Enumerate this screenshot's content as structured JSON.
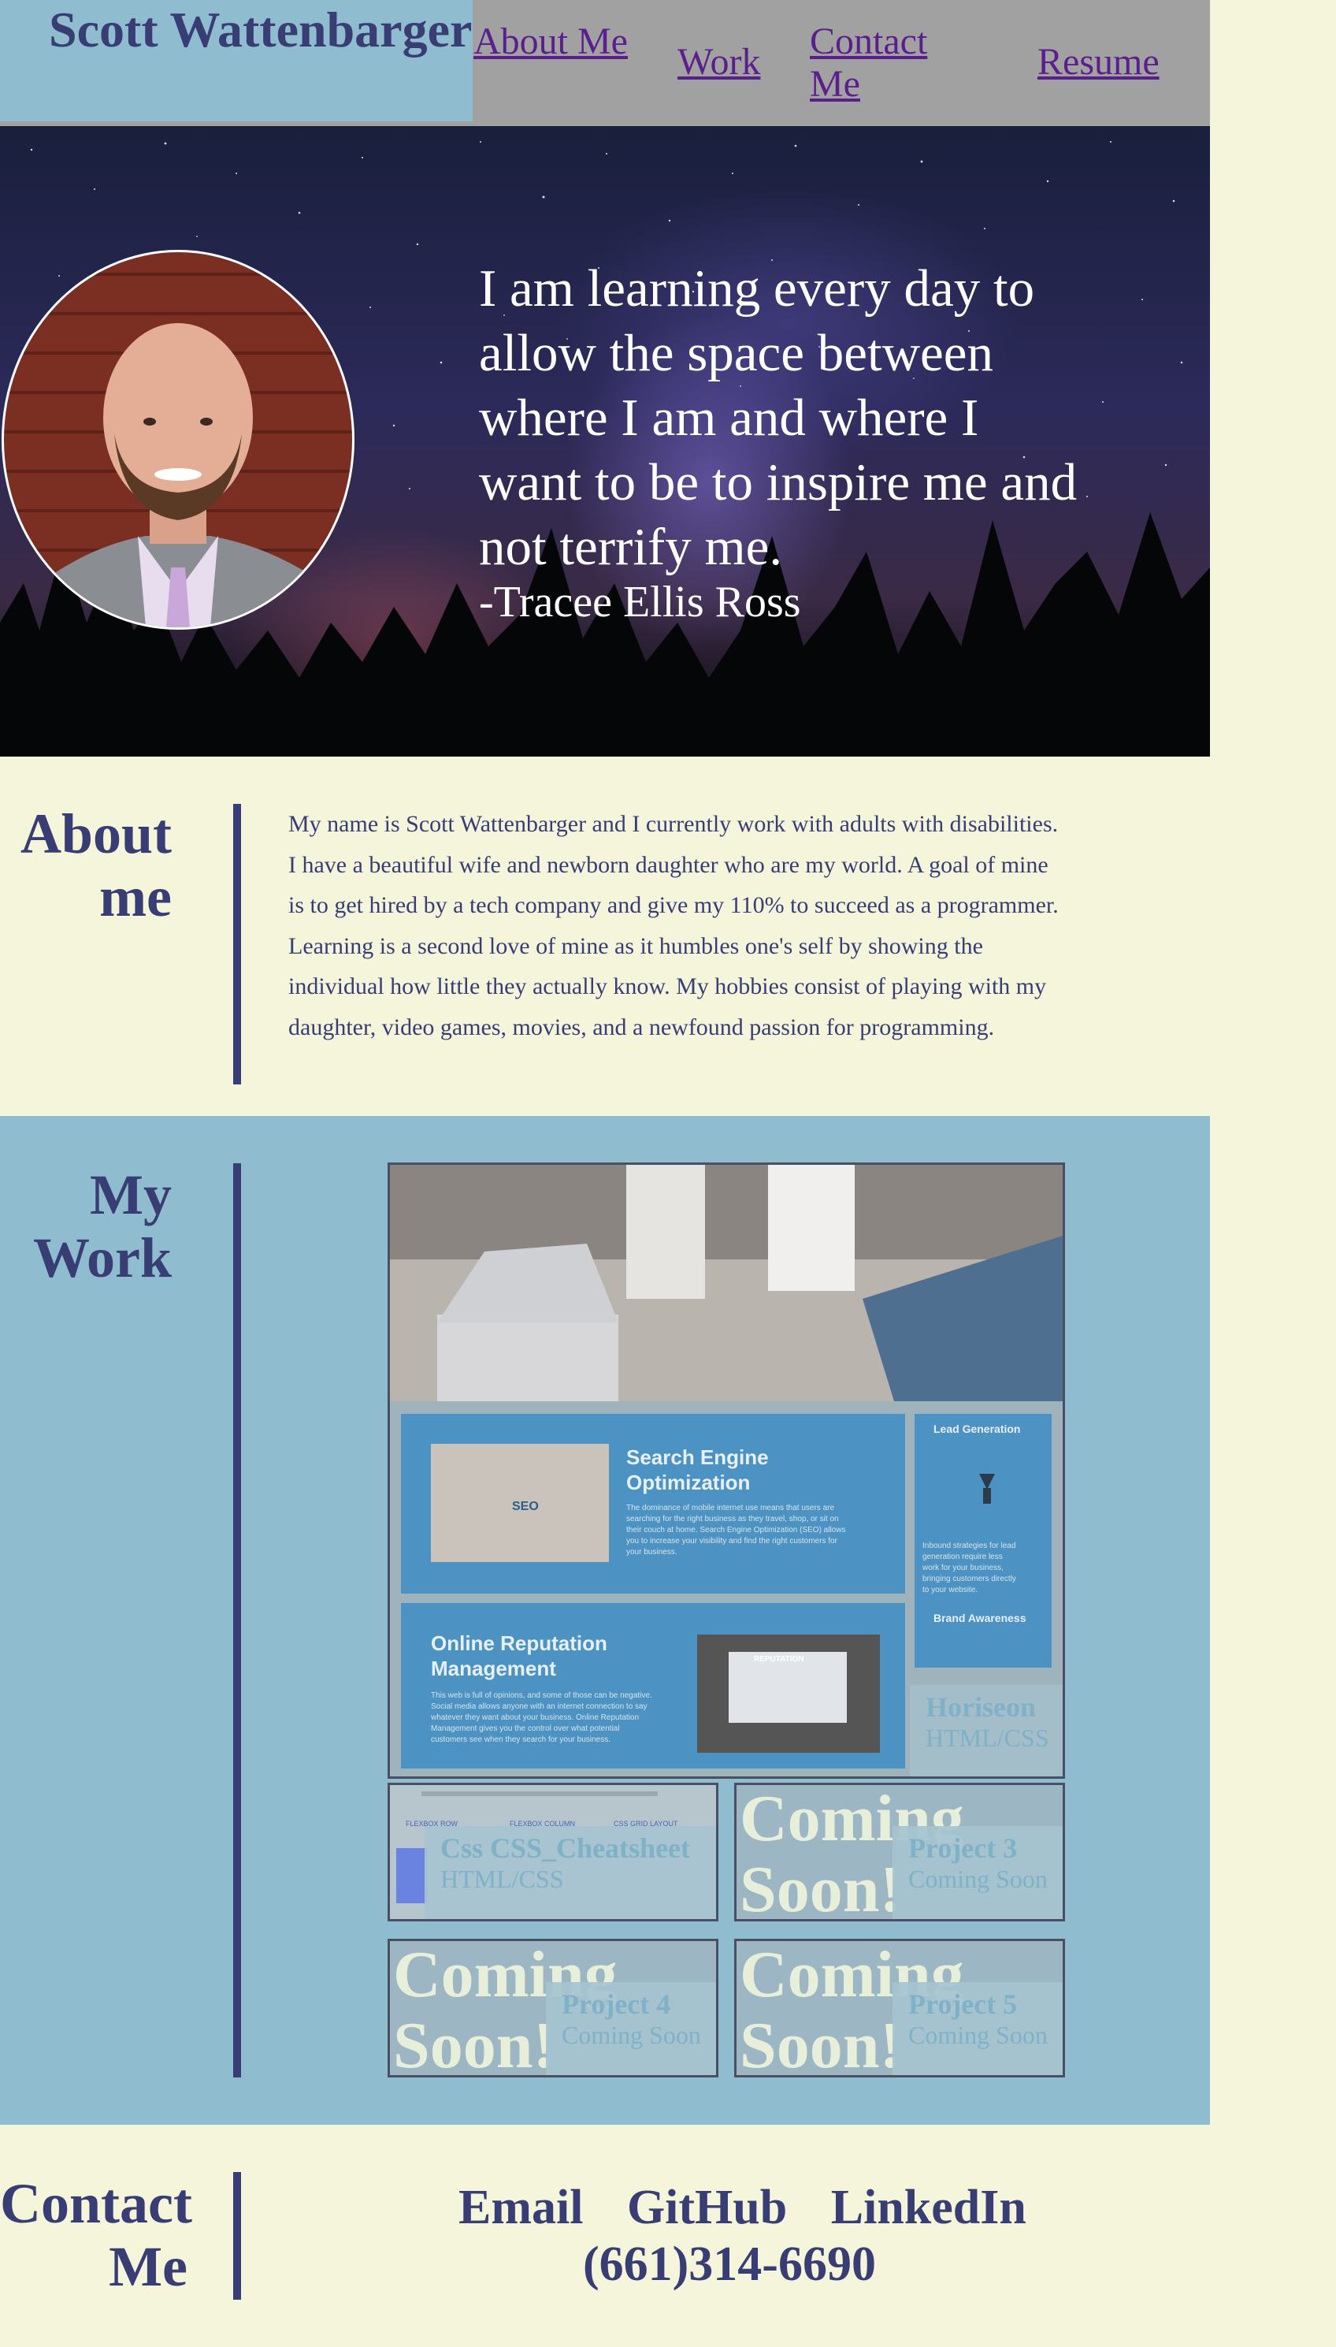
{
  "header": {
    "brand": "Scott Wattenbarger",
    "nav": [
      {
        "label": "About Me"
      },
      {
        "label": "Work"
      },
      {
        "label": "Contact Me"
      },
      {
        "label": "Resume"
      }
    ]
  },
  "hero": {
    "quote": "I am learning every day to allow the space between where I am and where I want to be to inspire me and not terrify me.",
    "author": "-Tracee Ellis Ross"
  },
  "about": {
    "heading": "About me",
    "text": "My name is Scott Wattenbarger and I currently work with adults with disabilities. I have a beautiful wife and newborn daughter who are my world. A goal of mine is to get hired by a tech company and give my 110% to succeed as a programmer. Learning is a second love of mine as it humbles one's self by showing the individual how little they actually know. My hobbies consist of playing with my daughter, video games, movies, and a newfound passion for programming."
  },
  "work": {
    "heading": "My Work",
    "featured": {
      "title": "Horiseon",
      "tech": "HTML/CSS",
      "screenshot": {
        "seo_title": "Search Engine Optimization",
        "seo_text": "The dominance of mobile internet use means that users are searching for the right business as they travel, shop, or sit on their couch at home. Search Engine Optimization (SEO) allows you to increase your visibility and find the right customers for your business.",
        "orm_title": "Online Reputation Management",
        "orm_text": "This web is full of opinions, and some of those can be negative. Social media allows anyone with an internet connection to say whatever they want about your business. Online Reputation Management gives you the control over what potential customers see when they search for your business.",
        "lead_title": "Lead Generation",
        "lead_text": "Inbound strategies for lead generation require less work for your business, bringing customers directly to your website.",
        "brand_title": "Brand Awareness",
        "badge": "SEO",
        "reputation_badge": "REPUTATION"
      }
    },
    "projects": [
      {
        "title": "Css CSS_Cheatsheet",
        "tech": "HTML/CSS"
      },
      {
        "title": "Project 3",
        "tech": "Coming Soon",
        "overlay": "Coming Soon!"
      },
      {
        "title": "Project 4",
        "tech": "Coming Soon",
        "overlay": "Coming Soon!"
      },
      {
        "title": "Project 5",
        "tech": "Coming Soon",
        "overlay": "Coming Soon!"
      }
    ],
    "cheatsheet_preview": [
      "FLEXBOX ROW",
      "FLEXBOX COLUMN",
      "CSS GRID LAYOUT"
    ]
  },
  "contact": {
    "heading": "Contact Me",
    "links": [
      {
        "label": "Email"
      },
      {
        "label": "GitHub"
      },
      {
        "label": "LinkedIn"
      }
    ],
    "phone": "(661)314-6690"
  },
  "colors": {
    "page_bg": "#f5f5dc",
    "header_bg": "#a1a1a1",
    "brand_bg": "#8fbcce",
    "accent": "#383e74",
    "link": "#5b1f8d",
    "work_bg": "#8fbcce"
  }
}
